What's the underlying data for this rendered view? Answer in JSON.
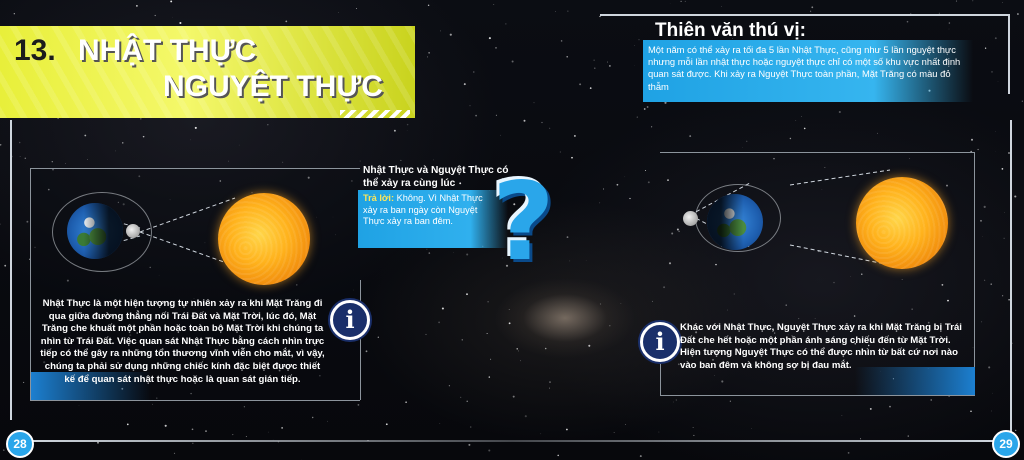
{
  "title": {
    "number": "13.",
    "line1": "NHẬT THỰC",
    "line2": "NGUYỆT THỰC"
  },
  "fact": {
    "heading": "Thiên văn thú vị:",
    "text": "Một năm có thể xảy ra tối đa 5 lần Nhật Thực, cũng như 5 lần nguyệt thực nhưng mỗi lần nhật thực hoặc nguyệt thực chỉ có một số khu vực nhất định quan sát được. Khi xảy ra Nguyệt Thực toàn phần, Mặt Trăng có màu đỏ thẫm"
  },
  "question": {
    "heading": "Nhật Thực và Nguyệt Thực có thể xảy ra cùng lúc",
    "answer_label": "Trả lời:",
    "answer_text": "Không. Vì Nhật Thực xảy ra ban ngày còn Nguyệt Thực xảy ra ban đêm.",
    "mark": "?"
  },
  "left_info": {
    "icon": "i",
    "text": "Nhật Thực là một hiện tượng tự nhiên xảy ra khi Mặt Trăng đi qua giữa đường thẳng nối Trái Đất và Mặt Trời, lúc đó, Mặt Trăng che khuất một phần hoặc toàn bộ Mặt Trời khi chúng ta nhìn từ Trái Đất. Việc quan sát Nhật Thực bằng cách nhìn trực tiếp có thể gây ra những tổn thương vĩnh viễn cho mắt, vì vậy, chúng ta phải sử dụng những chiếc kính đặc biệt được thiết kế để quan sát nhật thực hoặc là quan sát gián tiếp."
  },
  "right_info": {
    "icon": "i",
    "text": "Khác với Nhật Thực, Nguyệt Thực xảy ra khi Mặt Trăng bị Trái Đất che hết hoặc một phần ánh sáng chiếu đến từ Mặt Trời. Hiện tượng Nguyệt Thực có thể được nhìn từ bất cứ nơi nào vào ban đêm và không sợ bị đau mắt."
  },
  "pages": {
    "left": "28",
    "right": "29"
  },
  "colors": {
    "accent_blue": "#2aa6ea",
    "banner_yellow": "#e8ef3a",
    "sun_orange": "#f59a12"
  },
  "icons": [
    "info-icon",
    "question-mark-icon",
    "sun",
    "earth",
    "moon"
  ]
}
